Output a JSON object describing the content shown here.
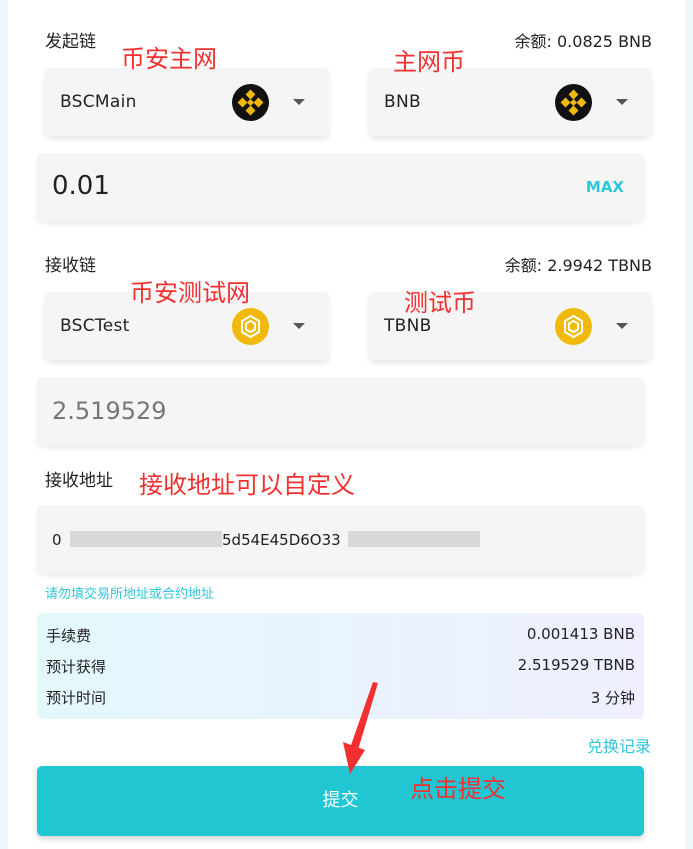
{
  "from": {
    "label": "发起链",
    "balance": "余额: 0.0825 BNB",
    "chain": "BSCMain",
    "token": "BNB",
    "amount": "0.01",
    "max_label": "MAX"
  },
  "to": {
    "label": "接收链",
    "balance": "余额: 2.9942 TBNB",
    "chain": "BSCTest",
    "token": "TBNB",
    "amount": "2.519529"
  },
  "address": {
    "label": "接收地址",
    "value_start": "0",
    "value_mid": "5d54E45D6O33",
    "hint": "请勿填交易所地址或合约地址"
  },
  "fees": [
    {
      "key": "手续费",
      "value": "0.001413 BNB"
    },
    {
      "key": "预计获得",
      "value": "2.519529 TBNB"
    },
    {
      "key": "预计时间",
      "value": "3 分钟"
    }
  ],
  "history_link": "兑换记录",
  "submit_label": "提交",
  "annotations": {
    "main_chain": "币安主网",
    "main_coin": "主网币",
    "test_chain": "币安测试网",
    "test_coin": "测试币",
    "address_note": "接收地址可以自定义",
    "click_submit": "点击提交"
  },
  "colors": {
    "accent": "#21c6d3",
    "annotation": "#f23030",
    "binance_yellow": "#f0b90b"
  }
}
